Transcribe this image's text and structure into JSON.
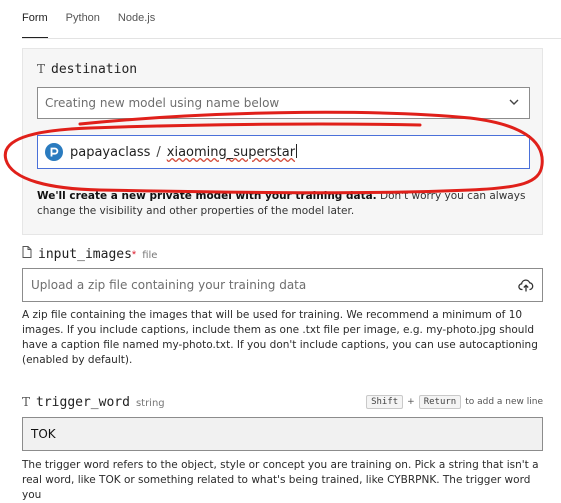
{
  "tabs": [
    {
      "label": "Form",
      "active": true
    },
    {
      "label": "Python",
      "active": false
    },
    {
      "label": "Node.js",
      "active": false
    }
  ],
  "destination": {
    "type_icon": "T",
    "label": "destination",
    "select_placeholder": "Creating new model using name below",
    "owner": "papayaclass",
    "separator": "/",
    "model_name": "xiaoming_superstar",
    "note_bold": "We'll create a new private model with your training data.",
    "note_rest": " Don't worry you can always change the visibility and other properties of the model later."
  },
  "input_images": {
    "label": "input_images",
    "required_mark": "*",
    "type": "file",
    "placeholder": "Upload a zip file containing your training data",
    "help": "A zip file containing the images that will be used for training. We recommend a minimum of 10 images. If you include captions, include them as one .txt file per image, e.g. my-photo.jpg should have a caption file named my-photo.txt. If you don't include captions, you can use autocaptioning (enabled by default)."
  },
  "trigger_word": {
    "type_icon": "T",
    "label": "trigger_word",
    "type": "string",
    "kbd_shift": "Shift",
    "plus": "+",
    "kbd_return": "Return",
    "kbd_hint": "to add a new line",
    "value": "TOK",
    "help": "The trigger word refers to the object, style or concept you are training on. Pick a string that isn't a real word, like TOK or something related to what's being trained, like CYBRPNK. The trigger word you"
  },
  "colors": {
    "focus_border": "#4a70d9",
    "annotation_red": "#e0201a",
    "required": "#dd2233"
  }
}
